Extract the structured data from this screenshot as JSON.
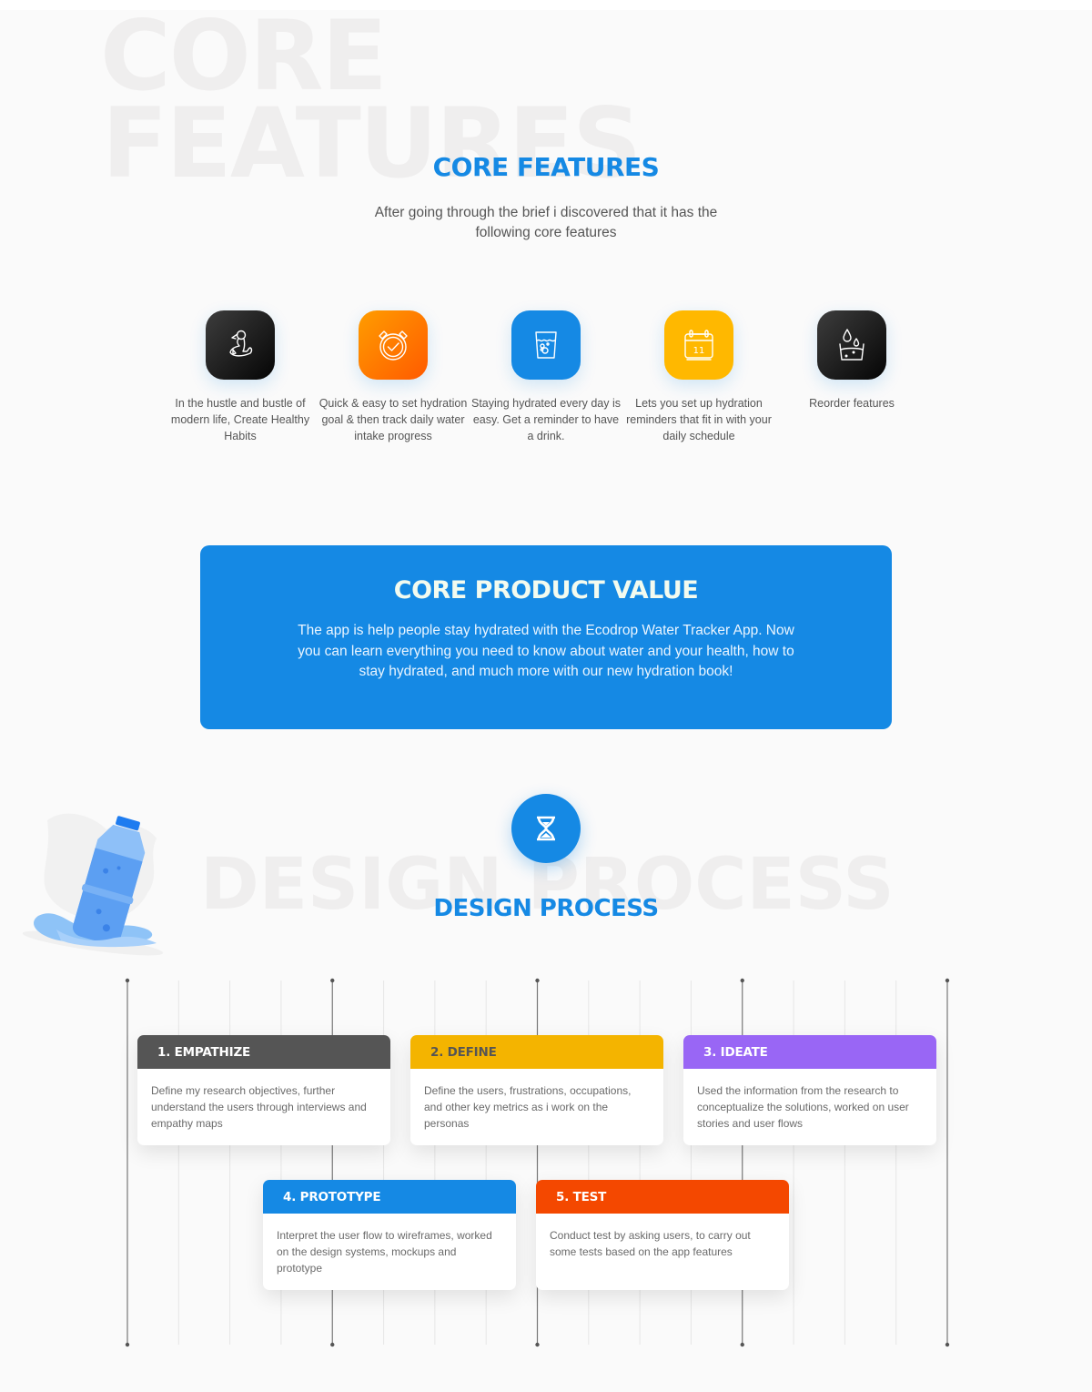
{
  "background_words": {
    "line1": "CORE",
    "line2": "FEATURES",
    "design": "DESIGN PROCESS"
  },
  "core_features": {
    "title": "CORE FEATURES",
    "subtitle": "After going through the brief i discovered that it has the following core features",
    "items": [
      {
        "icon": "fitness-figure-icon",
        "color": "#1a1a1a",
        "text": "In the hustle and bustle of modern life, Create Healthy Habits"
      },
      {
        "icon": "alarm-check-icon",
        "color": "#ff7a00",
        "text": "Quick & easy to set hydration goal & then track daily water intake progress"
      },
      {
        "icon": "water-glass-icon",
        "color": "#1589e4",
        "text": "Staying hydrated every day is easy. Get a reminder to have a drink."
      },
      {
        "icon": "calendar-icon",
        "color": "#ffb800",
        "calendar_day": "11",
        "text": "Lets you set up hydration reminders that fit in with your daily schedule"
      },
      {
        "icon": "water-drops-glass-icon",
        "color": "#1a1a1a",
        "text": "Reorder features"
      }
    ]
  },
  "core_product_value": {
    "title": "CORE PRODUCT VALUE",
    "text": "The app is help people stay hydrated with the Ecodrop Water Tracker App. Now you can learn everything you need to know about water and your health, how to stay hydrated, and much more with our new hydration book!",
    "color": "#1589e4"
  },
  "design_process": {
    "title": "DESIGN PROCESS",
    "icon": "hourglass-icon",
    "steps": [
      {
        "title": "1. EMPATHIZE",
        "color": "#555555",
        "title_color": "#ffffff",
        "text": "Define my research objectives, further understand the users through interviews and empathy maps"
      },
      {
        "title": "2. DEFINE",
        "color": "#f4b400",
        "title_color": "#555555",
        "text": "Define the users, frustrations, occupations, and other key metrics as i work on the personas"
      },
      {
        "title": "3. IDEATE",
        "color": "#9966f5",
        "title_color": "#ffffff",
        "text": "Used the information from the research to conceptualize the solutions, worked on user stories and user flows"
      },
      {
        "title": "4. PROTOTYPE",
        "color": "#1589e4",
        "title_color": "#ffffff",
        "text": "Interpret the user flow to wireframes, worked on the design systems, mockups and prototype"
      },
      {
        "title": "5. TEST",
        "color": "#f44800",
        "title_color": "#ffffff",
        "text": "Conduct test by asking users, to carry out some tests based on the app features"
      }
    ]
  }
}
